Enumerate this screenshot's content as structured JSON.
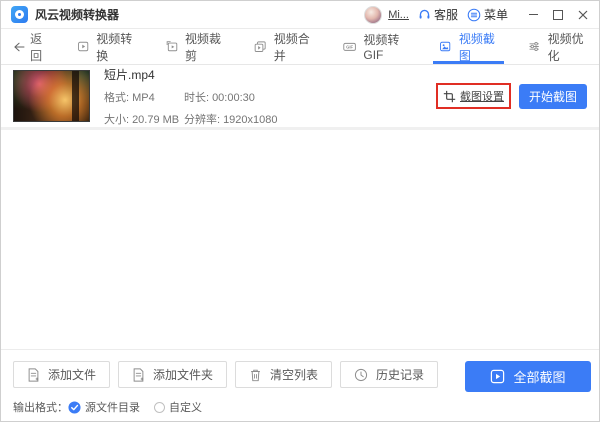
{
  "window": {
    "title": "风云视频转换器",
    "user": "Mi...",
    "service_label": "客服",
    "menu_label": "菜单"
  },
  "tabs": {
    "back_label": "返回",
    "items": [
      {
        "label": "视频转换",
        "icon": "video-convert-icon",
        "active": false
      },
      {
        "label": "视频裁剪",
        "icon": "video-crop-icon",
        "active": false
      },
      {
        "label": "视频合并",
        "icon": "video-merge-icon",
        "active": false
      },
      {
        "label": "视频转GIF",
        "icon": "video-to-gif-icon",
        "active": false
      },
      {
        "label": "视频截图",
        "icon": "video-screenshot-icon",
        "active": true
      },
      {
        "label": "视频优化",
        "icon": "video-optimize-icon",
        "active": false
      }
    ]
  },
  "file": {
    "name": "短片.mp4",
    "meta": [
      {
        "label": "格式:",
        "value": "MP4"
      },
      {
        "label": "时长:",
        "value": "00:00:30"
      },
      {
        "label": "大小:",
        "value": "20.79 MB"
      },
      {
        "label": "分辨率:",
        "value": "1920x1080"
      }
    ],
    "settings_label": "截图设置",
    "start_label": "开始截图"
  },
  "footer": {
    "buttons": [
      {
        "label": "添加文件",
        "icon": "add-file-icon"
      },
      {
        "label": "添加文件夹",
        "icon": "add-folder-icon"
      },
      {
        "label": "清空列表",
        "icon": "trash-icon"
      },
      {
        "label": "历史记录",
        "icon": "history-icon"
      }
    ],
    "screenshot_all_label": "全部截图",
    "output_format_label": "输出格式：",
    "output_options": [
      {
        "label": "源文件目录",
        "selected": true
      },
      {
        "label": "自定义",
        "selected": false
      }
    ]
  },
  "colors": {
    "accent": "#3b7cf6",
    "annotation_red": "#e02e24"
  },
  "icons": [
    "app-logo-icon",
    "avatar",
    "headset-icon",
    "menu-icon",
    "minimize-icon",
    "maximize-icon",
    "close-icon",
    "back-arrow-icon",
    "crop-icon",
    "play-icon",
    "clock-icon",
    "trash-icon",
    "radio-checked-icon",
    "radio-unchecked-icon"
  ]
}
